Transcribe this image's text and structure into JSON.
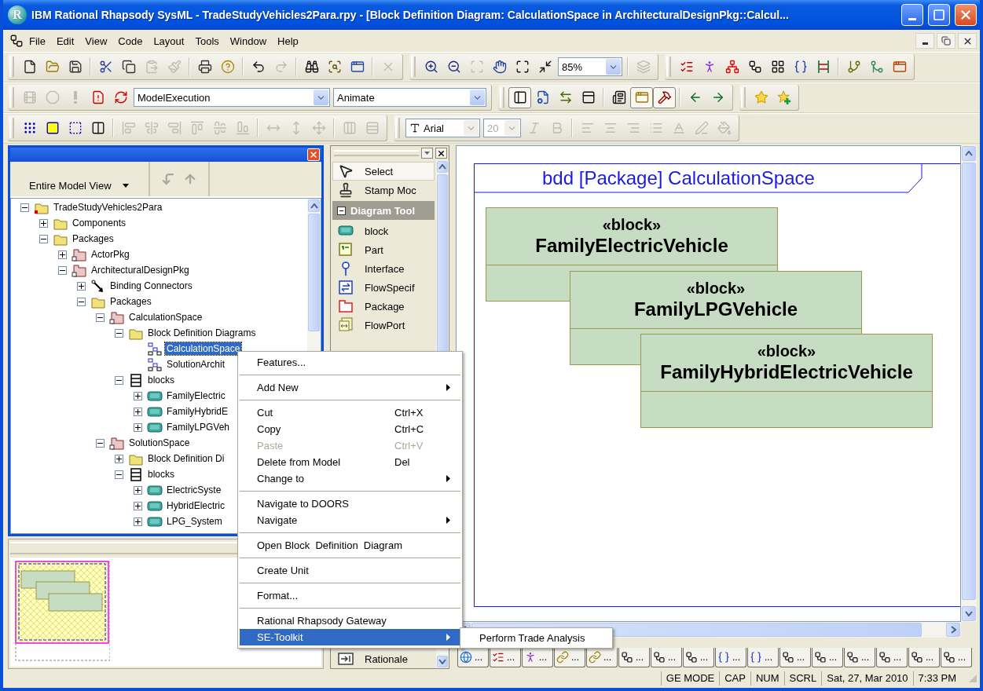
{
  "window": {
    "icon_letter": "R",
    "title": "IBM Rational Rhapsody SysML - TradeStudyVehicles2Para.rpy - [Block Definition Diagram: CalculationSpace in ArchitecturalDesignPkg::Calcul..."
  },
  "menu_bar": [
    "File",
    "Edit",
    "View",
    "Code",
    "Layout",
    "Tools",
    "Window",
    "Help"
  ],
  "toolbars": [
    {
      "bands": [
        {
          "items": [
            {
              "kind": "button",
              "disabled": false
            },
            {
              "kind": "button",
              "disabled": false
            },
            {
              "kind": "button",
              "disabled": false
            },
            {
              "kind": "separator"
            },
            {
              "kind": "button",
              "disabled": false
            },
            {
              "kind": "button",
              "disabled": false
            },
            {
              "kind": "button",
              "disabled": true
            },
            {
              "kind": "button",
              "disabled": true
            },
            {
              "kind": "separator"
            },
            {
              "kind": "button",
              "disabled": false
            },
            {
              "kind": "button",
              "disabled": false
            },
            {
              "kind": "separator"
            },
            {
              "kind": "button",
              "disabled": false
            },
            {
              "kind": "button",
              "disabled": true
            },
            {
              "kind": "separator"
            },
            {
              "kind": "button",
              "disabled": false
            },
            {
              "kind": "button",
              "disabled": false
            },
            {
              "kind": "button",
              "disabled": false
            },
            {
              "kind": "separator"
            },
            {
              "kind": "button",
              "disabled": true
            }
          ]
        },
        {
          "items": [
            {
              "kind": "button",
              "disabled": false
            },
            {
              "kind": "button",
              "disabled": false
            },
            {
              "kind": "button",
              "disabled": true
            },
            {
              "kind": "button",
              "disabled": false
            },
            {
              "kind": "button",
              "disabled": false
            },
            {
              "kind": "button",
              "disabled": false
            },
            {
              "kind": "combo",
              "value": "85%",
              "disabled": false
            },
            {
              "kind": "separator"
            },
            {
              "kind": "button",
              "disabled": true
            }
          ]
        },
        {
          "items": [
            {
              "kind": "button",
              "disabled": false
            },
            {
              "kind": "button",
              "disabled": false
            },
            {
              "kind": "button",
              "disabled": false
            },
            {
              "kind": "button",
              "disabled": false
            },
            {
              "kind": "button",
              "disabled": false
            },
            {
              "kind": "button",
              "disabled": false
            },
            {
              "kind": "button",
              "disabled": false
            },
            {
              "kind": "separator"
            },
            {
              "kind": "button",
              "disabled": false
            },
            {
              "kind": "button",
              "disabled": false
            },
            {
              "kind": "button",
              "disabled": false
            }
          ]
        }
      ]
    },
    {
      "bands": [
        {
          "items": [
            {
              "kind": "button",
              "disabled": true
            },
            {
              "kind": "button",
              "disabled": true
            },
            {
              "kind": "button",
              "disabled": true
            },
            {
              "kind": "button",
              "disabled": false
            },
            {
              "kind": "button",
              "disabled": false
            },
            {
              "kind": "combo",
              "value": "ModelExecution",
              "disabled": false
            },
            {
              "kind": "combo",
              "value": "Animate",
              "disabled": false
            }
          ]
        },
        {
          "items": [
            {
              "kind": "button",
              "disabled": false,
              "pressed": true
            },
            {
              "kind": "button",
              "disabled": false,
              "pressed": false
            },
            {
              "kind": "button",
              "disabled": false,
              "pressed": false
            },
            {
              "kind": "button",
              "disabled": false,
              "pressed": false
            },
            {
              "kind": "separator"
            },
            {
              "kind": "button",
              "disabled": false,
              "pressed": false
            },
            {
              "kind": "button",
              "disabled": false,
              "pressed": true
            },
            {
              "kind": "button",
              "disabled": false,
              "pressed": true
            },
            {
              "kind": "separator"
            },
            {
              "kind": "button",
              "disabled": false,
              "pressed": false
            },
            {
              "kind": "button",
              "disabled": false,
              "pressed": false
            }
          ]
        },
        {
          "items": [
            {
              "kind": "button",
              "disabled": false
            },
            {
              "kind": "button",
              "disabled": false
            }
          ]
        }
      ]
    },
    {
      "bands": [
        {
          "items": [
            {
              "kind": "button",
              "disabled": false
            },
            {
              "kind": "button",
              "disabled": false
            },
            {
              "kind": "button",
              "disabled": false
            },
            {
              "kind": "button",
              "disabled": false
            },
            {
              "kind": "separator"
            },
            {
              "kind": "button",
              "disabled": true
            },
            {
              "kind": "button",
              "disabled": true
            },
            {
              "kind": "button",
              "disabled": true
            },
            {
              "kind": "button",
              "disabled": true
            },
            {
              "kind": "button",
              "disabled": true
            },
            {
              "kind": "button",
              "disabled": true
            },
            {
              "kind": "separator"
            },
            {
              "kind": "button",
              "disabled": true
            },
            {
              "kind": "button",
              "disabled": true
            },
            {
              "kind": "button",
              "disabled": true
            },
            {
              "kind": "separator"
            },
            {
              "kind": "button",
              "disabled": true
            },
            {
              "kind": "button",
              "disabled": true
            }
          ]
        },
        {
          "items": [
            {
              "kind": "combo",
              "value": "Arial",
              "disabled": false
            },
            {
              "kind": "combo",
              "value": "20",
              "disabled": true
            },
            {
              "kind": "button",
              "disabled": true
            },
            {
              "kind": "button",
              "disabled": true
            },
            {
              "kind": "separator"
            },
            {
              "kind": "button",
              "disabled": true
            },
            {
              "kind": "button",
              "disabled": true
            },
            {
              "kind": "button",
              "disabled": true
            },
            {
              "kind": "button",
              "disabled": true
            },
            {
              "kind": "button",
              "disabled": true
            },
            {
              "kind": "button",
              "disabled": true
            },
            {
              "kind": "button",
              "disabled": true
            }
          ]
        }
      ]
    }
  ],
  "browser": {
    "view_selector": "Entire Model View",
    "nav_buttons": [
      {
        "disabled": true
      },
      {
        "disabled": true
      }
    ],
    "tree": [
      {
        "label": "TradeStudyVehicles2Para",
        "kind": "project",
        "expanded": true,
        "selected": false,
        "children": [
          {
            "label": "Components",
            "kind": "folder",
            "expanded": false,
            "selected": false
          },
          {
            "label": "Packages",
            "kind": "folder",
            "expanded": true,
            "selected": false,
            "children": [
              {
                "label": "ActorPkg",
                "kind": "package",
                "expanded": false,
                "selected": false
              },
              {
                "label": "ArchitecturalDesignPkg",
                "kind": "package",
                "expanded": true,
                "selected": false,
                "children": [
                  {
                    "label": "Binding Connectors",
                    "kind": "connectors",
                    "expanded": false,
                    "selected": false
                  },
                  {
                    "label": "Packages",
                    "kind": "folder",
                    "expanded": true,
                    "selected": false,
                    "children": [
                      {
                        "label": "CalculationSpace",
                        "kind": "package",
                        "expanded": true,
                        "selected": false,
                        "children": [
                          {
                            "label": "Block Definition Diagrams",
                            "kind": "folder",
                            "expanded": true,
                            "selected": false,
                            "children": [
                              {
                                "label": "CalculationSpace",
                                "kind": "diagram",
                                "selected": true
                              },
                              {
                                "label": "SolutionArchit",
                                "kind": "diagram",
                                "selected": false
                              }
                            ]
                          },
                          {
                            "label": "blocks",
                            "kind": "category",
                            "expanded": true,
                            "selected": false,
                            "children": [
                              {
                                "label": "FamilyElectric",
                                "kind": "block",
                                "expanded": false,
                                "selected": false
                              },
                              {
                                "label": "FamilyHybridE",
                                "kind": "block",
                                "expanded": false,
                                "selected": false
                              },
                              {
                                "label": "FamilyLPGVeh",
                                "kind": "block",
                                "expanded": false,
                                "selected": false
                              }
                            ]
                          }
                        ]
                      },
                      {
                        "label": "SolutionSpace",
                        "kind": "package",
                        "expanded": true,
                        "selected": false,
                        "children": [
                          {
                            "label": "Block Definition Di",
                            "kind": "folder",
                            "expanded": false,
                            "selected": false
                          },
                          {
                            "label": "blocks",
                            "kind": "category",
                            "expanded": true,
                            "selected": false,
                            "children": [
                              {
                                "label": "ElectricSyste",
                                "kind": "block",
                                "expanded": false,
                                "selected": false
                              },
                              {
                                "label": "HybridElectric",
                                "kind": "block",
                                "expanded": false,
                                "selected": false
                              },
                              {
                                "label": "LPG_System",
                                "kind": "block",
                                "expanded": false,
                                "selected": false
                              }
                            ]
                          }
                        ]
                      }
                    ]
                  }
                ]
              }
            ]
          }
        ]
      }
    ]
  },
  "palette": {
    "items": [
      {
        "kind": "tool",
        "label": "Select",
        "selected": true
      },
      {
        "kind": "tool",
        "label": "Stamp Moc",
        "selected": false
      },
      {
        "kind": "section",
        "label": "Diagram Tool",
        "expanded": true
      },
      {
        "kind": "tool",
        "label": "block",
        "selected": false
      },
      {
        "kind": "tool",
        "label": "Part",
        "selected": false
      },
      {
        "kind": "tool",
        "label": "Interface",
        "selected": false
      },
      {
        "kind": "tool",
        "label": "FlowSpecif",
        "selected": false
      },
      {
        "kind": "tool",
        "label": "Package",
        "selected": false
      },
      {
        "kind": "tool",
        "label": "FlowPort",
        "selected": false
      }
    ],
    "bottom_items": [
      {
        "kind": "tool",
        "label": "Rationale",
        "selected": false
      }
    ]
  },
  "diagram": {
    "frame_title": "bdd [Package] CalculationSpace",
    "blocks": [
      {
        "stereotype": "«block»",
        "name": "FamilyElectricVehicle"
      },
      {
        "stereotype": "«block»",
        "name": "FamilyLPGVehicle"
      },
      {
        "stereotype": "«block»",
        "name": "FamilyHybridElectricVehicle"
      }
    ]
  },
  "diagram_tabs": [
    {
      "label": "..."
    },
    {
      "label": "..."
    },
    {
      "label": "..."
    },
    {
      "label": "..."
    },
    {
      "label": "..."
    },
    {
      "label": "..."
    },
    {
      "label": "..."
    },
    {
      "label": "..."
    },
    {
      "label": "..."
    },
    {
      "label": "..."
    },
    {
      "label": "..."
    },
    {
      "label": "..."
    },
    {
      "label": "..."
    },
    {
      "label": "..."
    },
    {
      "label": "..."
    },
    {
      "label": "..."
    }
  ],
  "context_menu": {
    "items": [
      {
        "kind": "item",
        "label": "Features...",
        "disabled": false,
        "submenu": false,
        "selected": false
      },
      {
        "kind": "separator"
      },
      {
        "kind": "item",
        "label": "Add New",
        "disabled": false,
        "submenu": true,
        "selected": false
      },
      {
        "kind": "separator"
      },
      {
        "kind": "item",
        "label": "Cut",
        "shortcut": "Ctrl+X",
        "disabled": false,
        "submenu": false,
        "selected": false
      },
      {
        "kind": "item",
        "label": "Copy",
        "shortcut": "Ctrl+C",
        "disabled": false,
        "submenu": false,
        "selected": false
      },
      {
        "kind": "item",
        "label": "Paste",
        "shortcut": "Ctrl+V",
        "disabled": true,
        "submenu": false,
        "selected": false
      },
      {
        "kind": "item",
        "label": "Delete from Model",
        "shortcut": "Del",
        "disabled": false,
        "submenu": false,
        "selected": false
      },
      {
        "kind": "item",
        "label": "Change to",
        "disabled": false,
        "submenu": true,
        "selected": false
      },
      {
        "kind": "separator"
      },
      {
        "kind": "item",
        "label": "Navigate to DOORS",
        "disabled": false,
        "submenu": false,
        "selected": false
      },
      {
        "kind": "item",
        "label": "Navigate",
        "disabled": false,
        "submenu": true,
        "selected": false
      },
      {
        "kind": "separator"
      },
      {
        "kind": "item",
        "label": "Open Block  Definition  Diagram",
        "disabled": false,
        "submenu": false,
        "selected": false
      },
      {
        "kind": "separator"
      },
      {
        "kind": "item",
        "label": "Create Unit",
        "disabled": false,
        "submenu": false,
        "selected": false
      },
      {
        "kind": "separator"
      },
      {
        "kind": "item",
        "label": "Format...",
        "disabled": false,
        "submenu": false,
        "selected": false
      },
      {
        "kind": "separator"
      },
      {
        "kind": "item",
        "label": "Rational Rhapsody Gateway",
        "disabled": false,
        "submenu": false,
        "selected": false
      },
      {
        "kind": "item",
        "label": "SE-Toolkit",
        "disabled": false,
        "submenu": true,
        "selected": true
      }
    ]
  },
  "submenu": {
    "items": [
      {
        "label": "Perform Trade Analysis",
        "selected": false
      }
    ]
  },
  "status_bar": [
    "GE MODE",
    "CAP",
    "NUM",
    "SCRL",
    "Sat, 27, Mar 2010",
    "7:33 PM"
  ]
}
